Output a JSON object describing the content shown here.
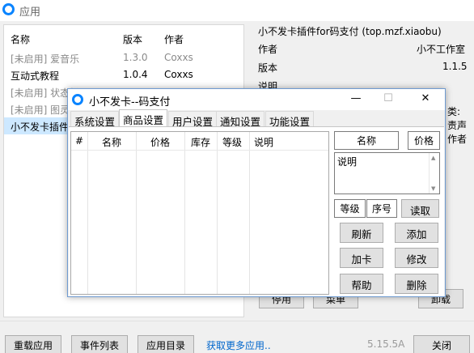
{
  "app": {
    "title": "应用"
  },
  "list": {
    "headers": {
      "name": "名称",
      "version": "版本",
      "author": "作者"
    },
    "rows": [
      {
        "name": "[未启用] 爱音乐",
        "version": "1.3.0",
        "author": "Coxxs",
        "disabled": true
      },
      {
        "name": "互动式教程",
        "version": "1.0.4",
        "author": "Coxxs",
        "disabled": false
      },
      {
        "name": "[未启用] 状态栏",
        "version": "",
        "author": "",
        "disabled": true
      },
      {
        "name": "[未启用] 图灵",
        "version": "",
        "author": "",
        "disabled": true
      },
      {
        "name": "小不发卡插件",
        "version": "",
        "author": "",
        "disabled": false,
        "selected": true
      }
    ]
  },
  "details": {
    "plugin_title": "小不发卡插件for码支付 (top.mzf.xiaobu)",
    "author_label": "作者",
    "author_value": "小不工作室",
    "version_label": "版本",
    "version_value": "1.1.5",
    "desc_label": "说明",
    "perm_label": "类:",
    "perm_line2": "责声",
    "perm_line3": "作者"
  },
  "buttons": {
    "disable": "停用",
    "menu": "菜单",
    "uninstall": "卸载",
    "reload": "重载应用",
    "events": "事件列表",
    "app_dir": "应用目录",
    "more": "获取更多应用..",
    "close": "关闭"
  },
  "version": "5.15.5A",
  "dialog": {
    "title": "小不发卡--码支付",
    "controls": {
      "minimize": "—",
      "maximize": "☐",
      "close": "✕"
    },
    "tabs": [
      "系统设置",
      "商品设置",
      "用户设置",
      "通知设置",
      "功能设置"
    ],
    "active_tab": 1,
    "table_headers": [
      "#",
      "名称",
      "价格",
      "库存",
      "等级",
      "说明"
    ],
    "name_field": "名称",
    "price_field": "价格",
    "description": "说明",
    "level_field": "等级",
    "serial_field": "序号",
    "buttons": {
      "read": "读取",
      "refresh": "刷新",
      "add": "添加",
      "add_card": "加卡",
      "modify": "修改",
      "help": "帮助",
      "delete": "删除"
    }
  },
  "colors": {
    "accent": "#0a84ff",
    "selection": "#cde8ff",
    "link": "#0066cc"
  }
}
